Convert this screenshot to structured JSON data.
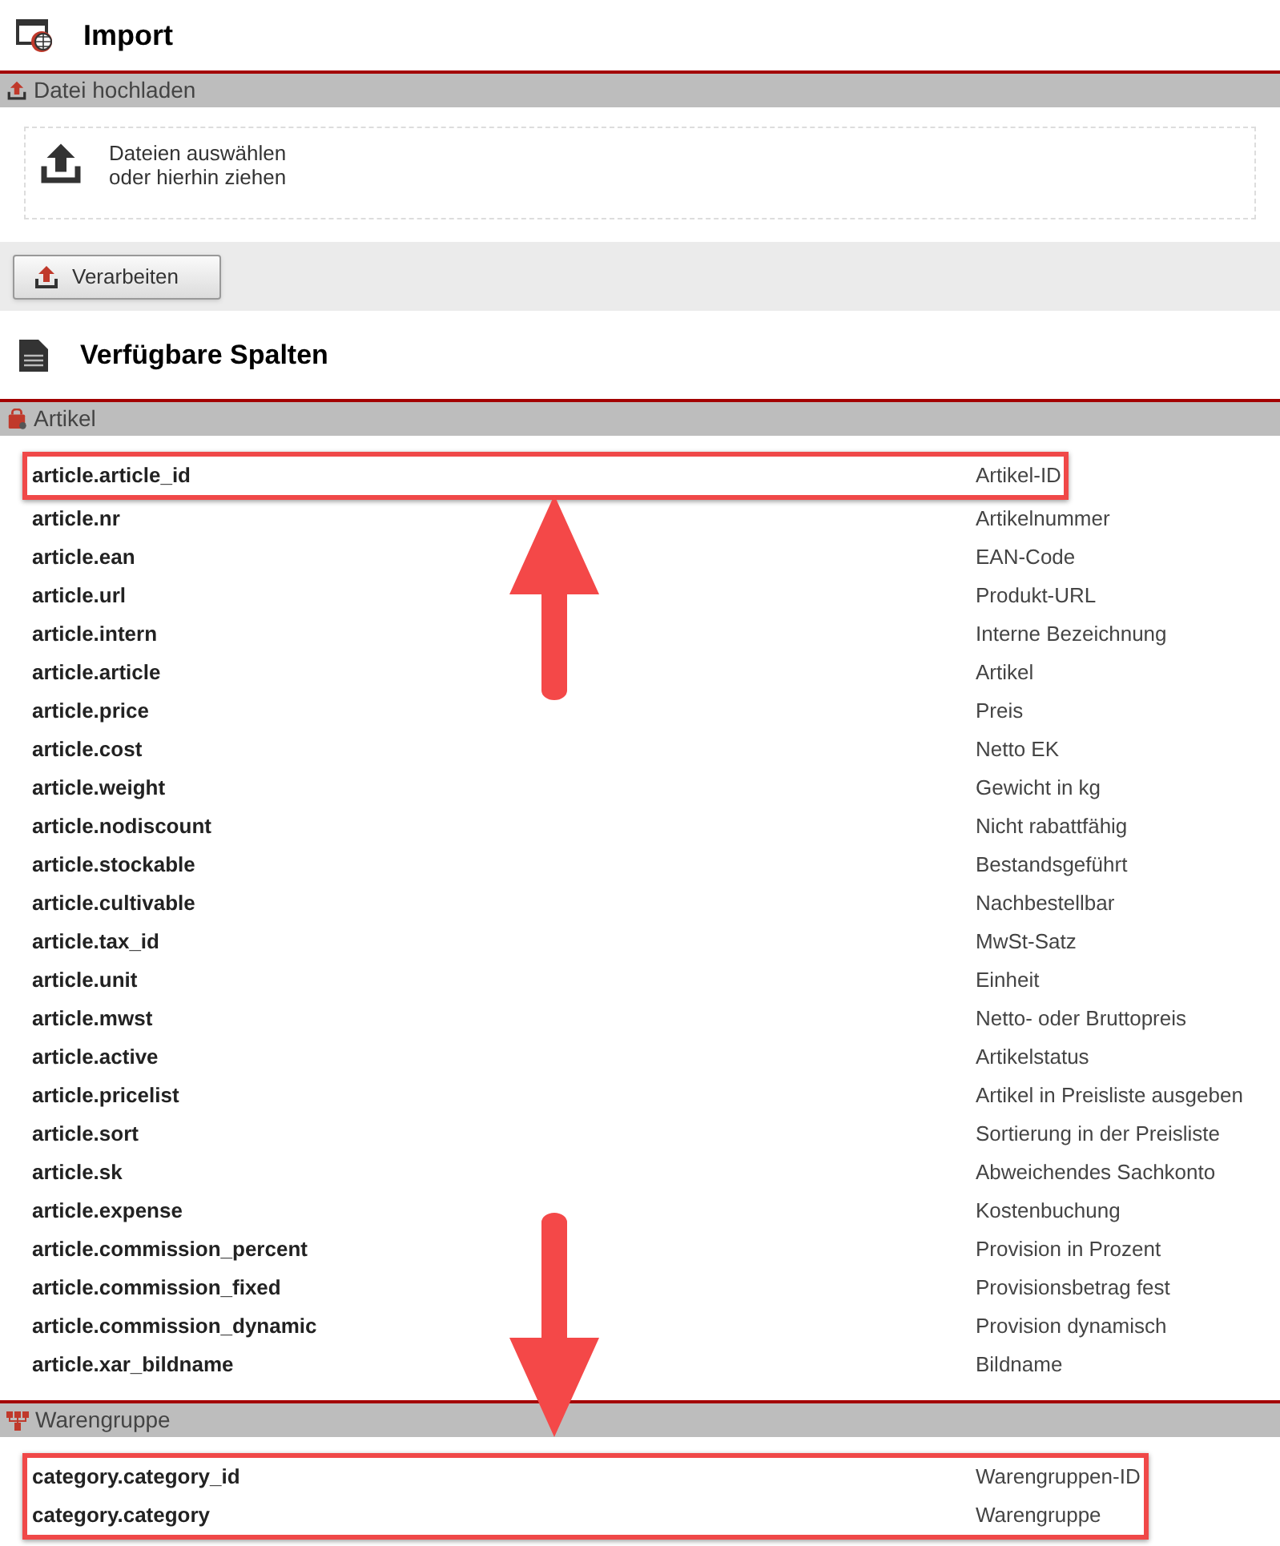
{
  "title": "Import",
  "upload_section": {
    "title": "Datei hochladen",
    "dropzone": [
      "Dateien auswählen",
      "oder hierhin ziehen"
    ]
  },
  "process_button": "Verarbeiten",
  "columns_title": "Verfügbare Spalten",
  "groups": [
    {
      "kind": "article",
      "title": "Artikel",
      "rows": [
        {
          "key": "article.article_id",
          "label": "Artikel-ID",
          "highlighted": true
        },
        {
          "key": "article.nr",
          "label": "Artikelnummer",
          "highlighted": false
        },
        {
          "key": "article.ean",
          "label": "EAN-Code",
          "highlighted": false
        },
        {
          "key": "article.url",
          "label": "Produkt-URL",
          "highlighted": false
        },
        {
          "key": "article.intern",
          "label": "Interne Bezeichnung",
          "highlighted": false
        },
        {
          "key": "article.article",
          "label": "Artikel",
          "highlighted": false
        },
        {
          "key": "article.price",
          "label": "Preis",
          "highlighted": false
        },
        {
          "key": "article.cost",
          "label": "Netto EK",
          "highlighted": false
        },
        {
          "key": "article.weight",
          "label": "Gewicht in kg",
          "highlighted": false
        },
        {
          "key": "article.nodiscount",
          "label": "Nicht rabattfähig",
          "highlighted": false
        },
        {
          "key": "article.stockable",
          "label": "Bestandsgeführt",
          "highlighted": false
        },
        {
          "key": "article.cultivable",
          "label": "Nachbestellbar",
          "highlighted": false
        },
        {
          "key": "article.tax_id",
          "label": "MwSt-Satz",
          "highlighted": false
        },
        {
          "key": "article.unit",
          "label": "Einheit",
          "highlighted": false
        },
        {
          "key": "article.mwst",
          "label": "Netto- oder Bruttopreis",
          "highlighted": false
        },
        {
          "key": "article.active",
          "label": "Artikelstatus",
          "highlighted": false
        },
        {
          "key": "article.pricelist",
          "label": "Artikel in Preisliste ausgeben",
          "highlighted": false
        },
        {
          "key": "article.sort",
          "label": "Sortierung in der Preisliste",
          "highlighted": false
        },
        {
          "key": "article.sk",
          "label": "Abweichendes Sachkonto",
          "highlighted": false
        },
        {
          "key": "article.expense",
          "label": "Kostenbuchung",
          "highlighted": false
        },
        {
          "key": "article.commission_percent",
          "label": "Provision in Prozent",
          "highlighted": false
        },
        {
          "key": "article.commission_fixed",
          "label": "Provisionsbetrag fest",
          "highlighted": false
        },
        {
          "key": "article.commission_dynamic",
          "label": "Provision dynamisch",
          "highlighted": false
        },
        {
          "key": "article.xar_bildname",
          "label": "Bildname",
          "highlighted": false
        }
      ]
    },
    {
      "kind": "category",
      "title": "Warengruppe",
      "rows": [
        {
          "key": "category.category_id",
          "label": "Warengruppen-ID",
          "highlighted": true
        },
        {
          "key": "category.category",
          "label": "Warengruppe",
          "highlighted": true
        }
      ]
    }
  ]
}
